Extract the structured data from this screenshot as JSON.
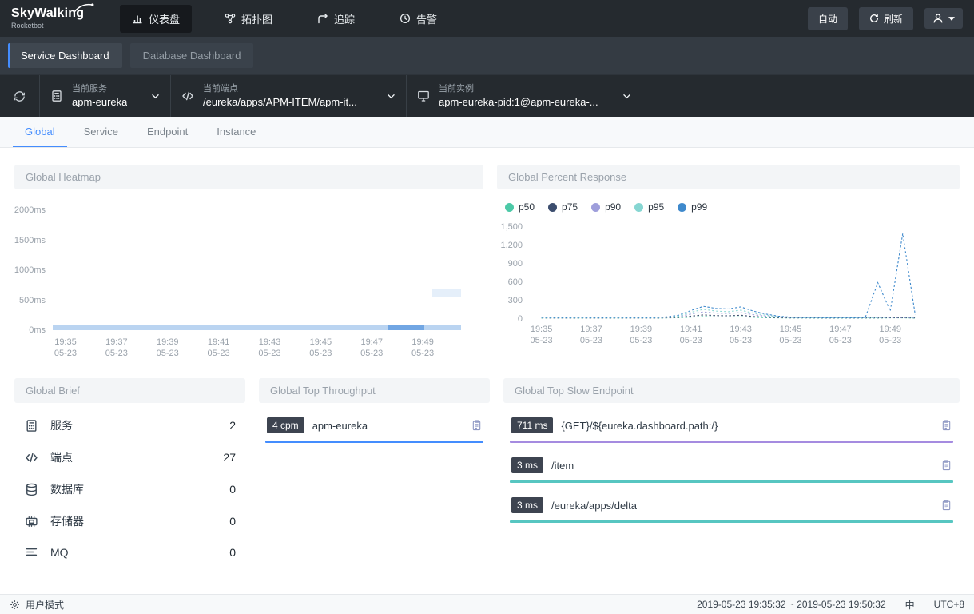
{
  "colors": {
    "accent": "#448dfe",
    "navbar_bg": "#252a2f",
    "badge_bg": "#3d4450"
  },
  "navbar": {
    "logo": "SkyWalking",
    "logo_sub": "Rocketbot",
    "items": [
      {
        "label": "仪表盘",
        "active": true
      },
      {
        "label": "拓扑图",
        "active": false
      },
      {
        "label": "追踪",
        "active": false
      },
      {
        "label": "告警",
        "active": false
      }
    ],
    "auto_button": "自动",
    "refresh_button": "刷新"
  },
  "dashboard_tabs": [
    {
      "label": "Service Dashboard",
      "active": true
    },
    {
      "label": "Database Dashboard",
      "active": false
    }
  ],
  "selector_bar": {
    "selectors": [
      {
        "label": "当前服务",
        "value": "apm-eureka"
      },
      {
        "label": "当前端点",
        "value": "/eureka/apps/APM-ITEM/apm-it..."
      },
      {
        "label": "当前实例",
        "value": "apm-eureka-pid:1@apm-eureka-..."
      }
    ]
  },
  "scope_tabs": [
    {
      "label": "Global",
      "active": true
    },
    {
      "label": "Service",
      "active": false
    },
    {
      "label": "Endpoint",
      "active": false
    },
    {
      "label": "Instance",
      "active": false
    }
  ],
  "cards": {
    "brief": {
      "title": "Global Brief",
      "rows": [
        {
          "icon": "service-icon",
          "label": "服务",
          "value": "2"
        },
        {
          "icon": "endpoint-icon",
          "label": "端点",
          "value": "27"
        },
        {
          "icon": "database-icon",
          "label": "数据库",
          "value": "0"
        },
        {
          "icon": "storage-icon",
          "label": "存储器",
          "value": "0"
        },
        {
          "icon": "mq-icon",
          "label": "MQ",
          "value": "0"
        }
      ]
    },
    "throughput": {
      "title": "Global Top Throughput",
      "rows": [
        {
          "badge": "4 cpm",
          "name": "apm-eureka",
          "bar_color": "#448dfe"
        }
      ]
    },
    "slow": {
      "title": "Global Top Slow Endpoint",
      "rows": [
        {
          "badge": "711 ms",
          "name": "{GET}/${eureka.dashboard.path:/}",
          "bar_color": "#a58be0"
        },
        {
          "badge": "3 ms",
          "name": "/item",
          "bar_color": "#57c6c1"
        },
        {
          "badge": "3 ms",
          "name": "/eureka/apps/delta",
          "bar_color": "#57c6c1"
        }
      ]
    }
  },
  "chart_data": [
    {
      "type": "heatmap",
      "title": "Global Heatmap",
      "y_ticks": [
        "2000ms",
        "1500ms",
        "1000ms",
        "500ms",
        "0ms"
      ],
      "ymax_ms": 2000,
      "x_ticks": [
        "19:35",
        "19:37",
        "19:39",
        "19:41",
        "19:43",
        "19:45",
        "19:47",
        "19:49"
      ],
      "x_tick_sub": "05-23",
      "cell_color": "#4a8edb",
      "cells": [
        {
          "x0": 0.0,
          "x1": 1.0,
          "bucket_low_ms": 0,
          "bucket_high_ms": 100,
          "intensity": 0.38
        },
        {
          "x0": 0.82,
          "x1": 0.91,
          "bucket_low_ms": 0,
          "bucket_high_ms": 100,
          "intensity": 0.65
        },
        {
          "x0": 0.93,
          "x1": 1.0,
          "bucket_low_ms": 550,
          "bucket_high_ms": 700,
          "intensity": 0.14
        }
      ]
    },
    {
      "type": "line",
      "title": "Global Percent Response",
      "unit": "ms",
      "ymax": 1500,
      "y_ticks": [
        0,
        300,
        600,
        900,
        1200,
        1500
      ],
      "y_tick_labels": [
        "0",
        "300",
        "600",
        "900",
        "1,200",
        "1,500"
      ],
      "x_ticks": [
        "19:35",
        "19:37",
        "19:39",
        "19:41",
        "19:43",
        "19:45",
        "19:47",
        "19:49"
      ],
      "x_tick_sub": "05-23",
      "interval_seconds": 30,
      "legend_position": "top-left",
      "line_style": "dashed",
      "series": [
        {
          "name": "p50",
          "color": "#4cc9a7",
          "values": [
            3,
            3,
            2,
            3,
            3,
            2,
            3,
            3,
            3,
            2,
            4,
            8,
            18,
            28,
            22,
            20,
            25,
            16,
            10,
            6,
            4,
            4,
            3,
            3,
            3,
            3,
            3,
            3,
            5,
            5,
            3
          ]
        },
        {
          "name": "p75",
          "color": "#3c4d6e",
          "values": [
            5,
            4,
            3,
            5,
            4,
            3,
            5,
            4,
            4,
            3,
            7,
            14,
            35,
            55,
            45,
            40,
            50,
            30,
            18,
            10,
            6,
            5,
            5,
            4,
            5,
            4,
            5,
            5,
            8,
            8,
            5
          ]
        },
        {
          "name": "p90",
          "color": "#9e9edb",
          "values": [
            8,
            6,
            5,
            8,
            6,
            5,
            8,
            6,
            6,
            5,
            12,
            25,
            70,
            105,
            85,
            80,
            95,
            60,
            35,
            18,
            10,
            8,
            8,
            6,
            8,
            6,
            8,
            8,
            14,
            14,
            8
          ]
        },
        {
          "name": "p95",
          "color": "#86d6d2",
          "values": [
            10,
            8,
            6,
            10,
            8,
            6,
            10,
            8,
            8,
            6,
            16,
            35,
            100,
            150,
            120,
            110,
            135,
            85,
            50,
            25,
            14,
            10,
            10,
            8,
            10,
            8,
            10,
            10,
            20,
            20,
            10
          ]
        },
        {
          "name": "p99",
          "color": "#3e89cc",
          "values": [
            14,
            10,
            8,
            14,
            10,
            8,
            14,
            10,
            10,
            8,
            22,
            50,
            130,
            200,
            165,
            155,
            190,
            120,
            70,
            35,
            18,
            14,
            14,
            10,
            14,
            10,
            14,
            600,
            120,
            1430,
            60
          ]
        }
      ]
    }
  ],
  "footer": {
    "left_label": "用户模式",
    "time_range": "2019-05-23 19:35:32 ~ 2019-05-23 19:50:32",
    "lang": "中",
    "timezone": "UTC+8"
  }
}
